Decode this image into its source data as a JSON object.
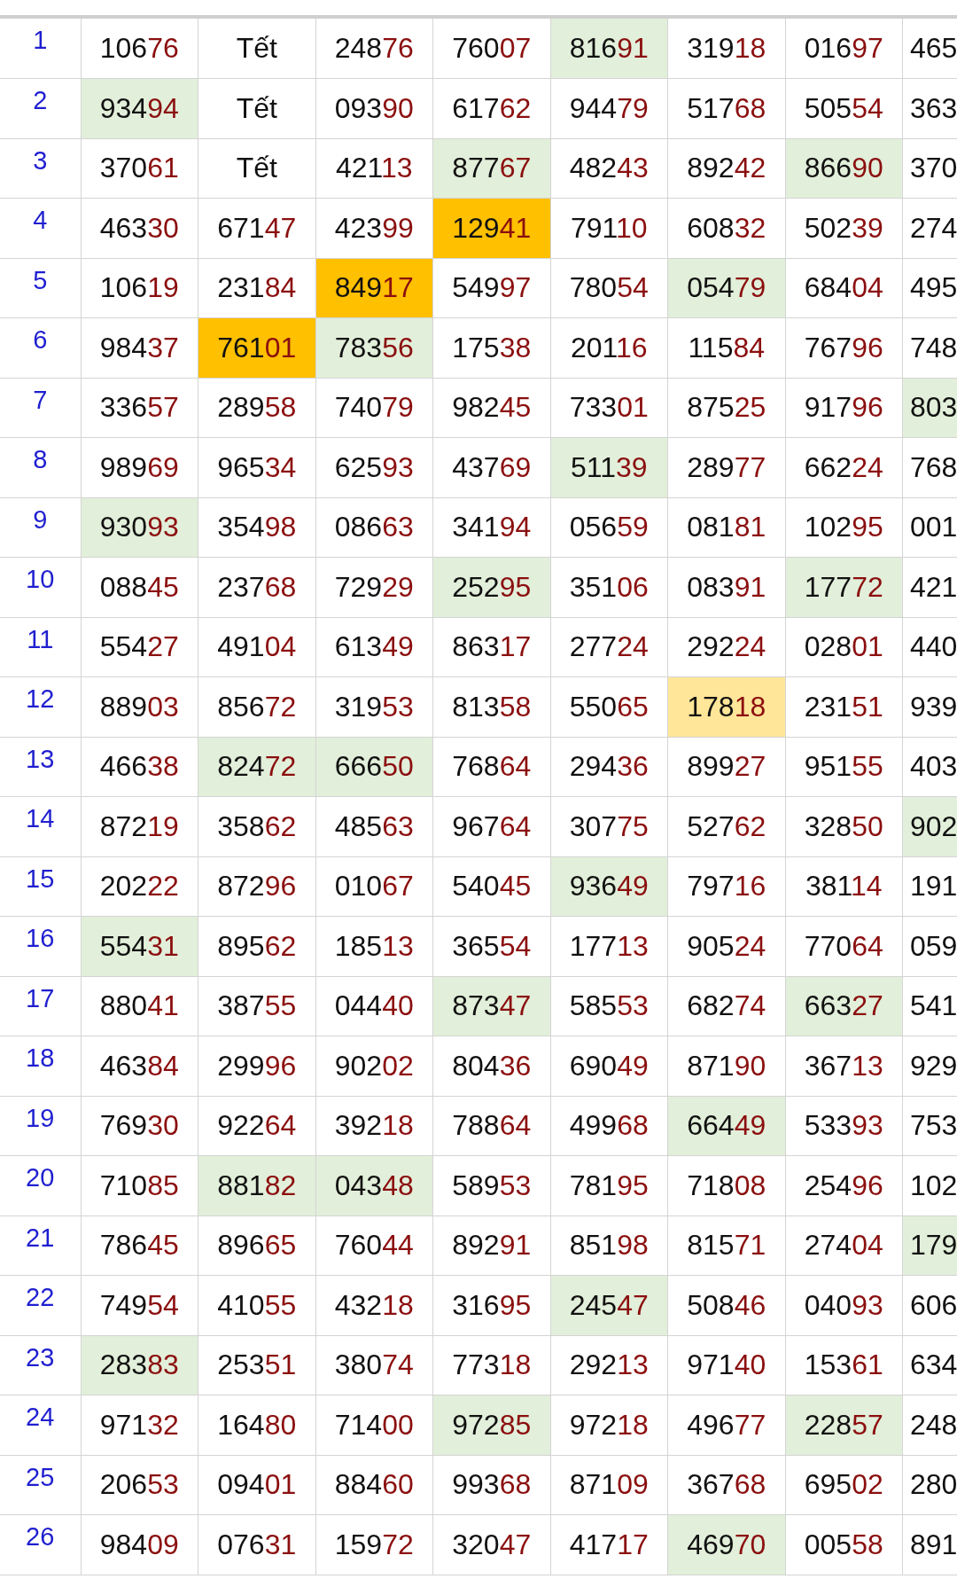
{
  "rows": [
    {
      "label": "1",
      "cells": [
        "10676",
        "Tết",
        "24876",
        "76007",
        {
          "text": "81691",
          "color": "#e2efda"
        },
        "31918",
        "01697",
        "465"
      ]
    },
    {
      "label": "2",
      "cells": [
        {
          "text": "93494",
          "color": "#e2efda"
        },
        "Tết",
        "09390",
        "61762",
        "94479",
        "51768",
        "50554",
        "363"
      ]
    },
    {
      "label": "3",
      "cells": [
        "37061",
        "Tết",
        "42113",
        {
          "text": "87767",
          "color": "#e2efda"
        },
        "48243",
        "89242",
        {
          "text": "86690",
          "color": "#e2efda"
        },
        "370"
      ]
    },
    {
      "label": "4",
      "cells": [
        "46330",
        "67147",
        "42399",
        {
          "text": "12941",
          "color": "#ffc000"
        },
        "79110",
        "60832",
        "50239",
        "274"
      ]
    },
    {
      "label": "5",
      "cells": [
        "10619",
        "23184",
        {
          "text": "84917",
          "color": "#ffc000"
        },
        "54997",
        "78054",
        {
          "text": "05479",
          "color": "#e2efda"
        },
        "68404",
        "495"
      ]
    },
    {
      "label": "6",
      "cells": [
        "98437",
        {
          "text": "76101",
          "color": "#ffc000"
        },
        {
          "text": "78356",
          "color": "#e2efda"
        },
        "17538",
        "20116",
        "11584",
        "76796",
        "748"
      ]
    },
    {
      "label": "7",
      "cells": [
        "33657",
        "28958",
        "74079",
        "98245",
        "73301",
        "87525",
        "91796",
        {
          "text": "803",
          "color": "#e2efda"
        }
      ]
    },
    {
      "label": "8",
      "cells": [
        "98969",
        "96534",
        "62593",
        "43769",
        {
          "text": "51139",
          "color": "#e2efda"
        },
        "28977",
        "66224",
        "768"
      ]
    },
    {
      "label": "9",
      "cells": [
        {
          "text": "93093",
          "color": "#e2efda"
        },
        "35498",
        "08663",
        "34194",
        "05659",
        "08181",
        "10295",
        "001"
      ]
    },
    {
      "label": "10",
      "cells": [
        "08845",
        "23768",
        "72929",
        {
          "text": "25295",
          "color": "#e2efda"
        },
        "35106",
        "08391",
        {
          "text": "17772",
          "color": "#e2efda"
        },
        "421"
      ]
    },
    {
      "label": "11",
      "cells": [
        "55427",
        "49104",
        "61349",
        "86317",
        "27724",
        "29224",
        "02801",
        "440"
      ]
    },
    {
      "label": "12",
      "cells": [
        "88903",
        "85672",
        "31953",
        "81358",
        "55065",
        {
          "text": "17818",
          "color": "#ffe699"
        },
        "23151",
        "939"
      ]
    },
    {
      "label": "13",
      "cells": [
        "46638",
        {
          "text": "82472",
          "color": "#e2efda"
        },
        {
          "text": "66650",
          "color": "#e2efda"
        },
        "76864",
        "29436",
        "89927",
        "95155",
        "403"
      ]
    },
    {
      "label": "14",
      "cells": [
        "87219",
        "35862",
        "48563",
        "96764",
        "30775",
        "52762",
        "32850",
        {
          "text": "902",
          "color": "#e2efda"
        }
      ]
    },
    {
      "label": "15",
      "cells": [
        "20222",
        "87296",
        "01067",
        "54045",
        {
          "text": "93649",
          "color": "#e2efda"
        },
        "79716",
        "38114",
        "191"
      ]
    },
    {
      "label": "16",
      "cells": [
        {
          "text": "55431",
          "color": "#e2efda"
        },
        "89562",
        "18513",
        "36554",
        "17713",
        "90524",
        "77064",
        "059"
      ]
    },
    {
      "label": "17",
      "cells": [
        "88041",
        "38755",
        "04440",
        {
          "text": "87347",
          "color": "#e2efda"
        },
        "58553",
        "68274",
        {
          "text": "66327",
          "color": "#e2efda"
        },
        "541"
      ]
    },
    {
      "label": "18",
      "cells": [
        "46384",
        "29996",
        "90202",
        "80436",
        "69049",
        "87190",
        "36713",
        "929"
      ]
    },
    {
      "label": "19",
      "cells": [
        "76930",
        "92264",
        "39218",
        "78864",
        "49968",
        {
          "text": "66449",
          "color": "#e2efda"
        },
        "53393",
        "753"
      ]
    },
    {
      "label": "20",
      "cells": [
        "71085",
        {
          "text": "88182",
          "color": "#e2efda"
        },
        {
          "text": "04348",
          "color": "#e2efda"
        },
        "58953",
        "78195",
        "71808",
        "25496",
        "102"
      ]
    },
    {
      "label": "21",
      "cells": [
        "78645",
        "89665",
        "76044",
        "89291",
        "85198",
        "81571",
        "27404",
        {
          "text": "179",
          "color": "#e2efda"
        }
      ]
    },
    {
      "label": "22",
      "cells": [
        "74954",
        "41055",
        "43218",
        "31695",
        {
          "text": "24547",
          "color": "#e2efda"
        },
        "50846",
        "04093",
        "606"
      ]
    },
    {
      "label": "23",
      "cells": [
        {
          "text": "28383",
          "color": "#e2efda"
        },
        "25351",
        "38074",
        "77318",
        "29213",
        "97140",
        "15361",
        "634"
      ]
    },
    {
      "label": "24",
      "cells": [
        "97132",
        "16480",
        "71400",
        {
          "text": "97285",
          "color": "#e2efda"
        },
        "97218",
        "49677",
        {
          "text": "22857",
          "color": "#e2efda"
        },
        "248"
      ]
    },
    {
      "label": "25",
      "cells": [
        "20653",
        "09401",
        "88460",
        "99368",
        "87109",
        "36768",
        "69502",
        "280"
      ]
    },
    {
      "label": "26",
      "cells": [
        "98409",
        "07631",
        "15972",
        "32047",
        "41717",
        {
          "text": "46970",
          "color": "#e2efda"
        },
        "00558",
        "891"
      ]
    }
  ]
}
